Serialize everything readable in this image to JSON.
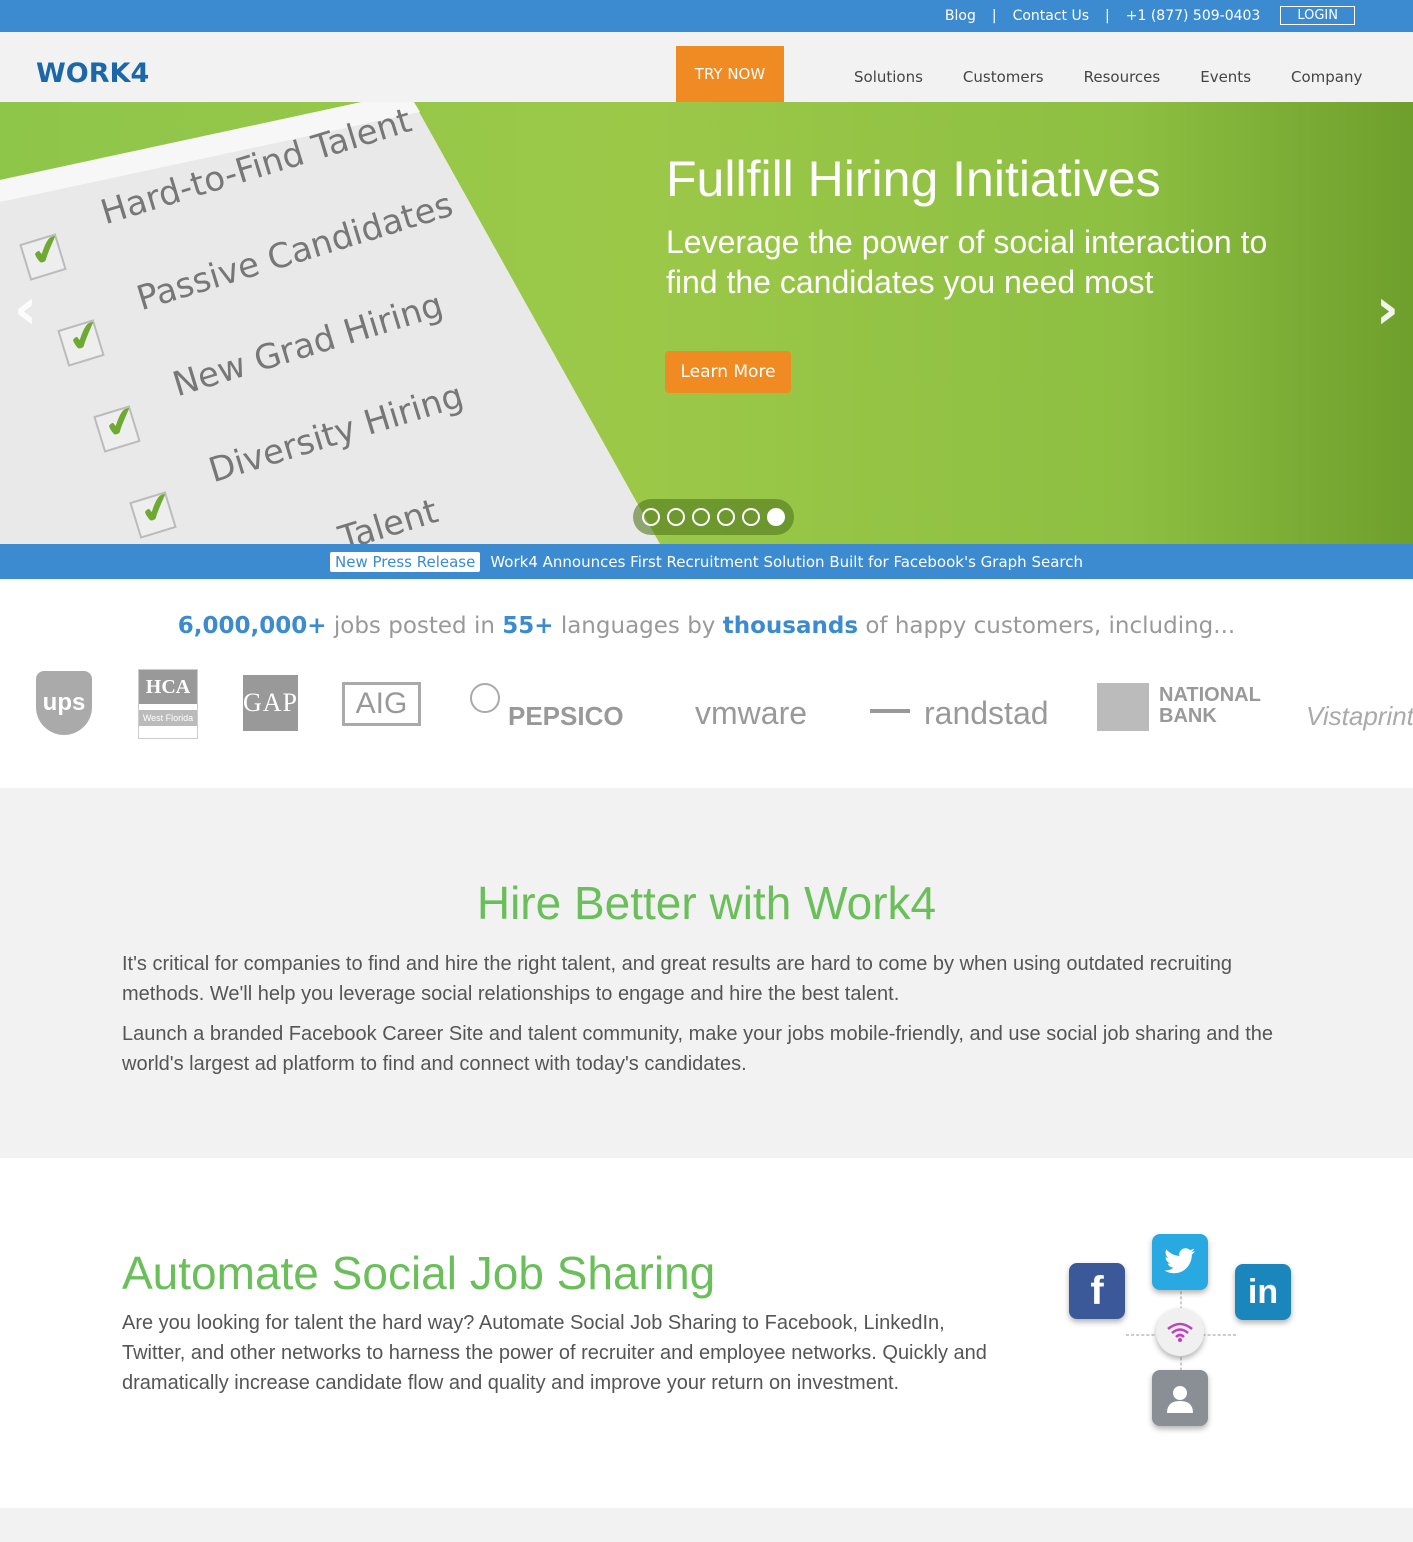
{
  "topbar": {
    "blog": "Blog",
    "contact": "Contact Us",
    "phone": "+1 (877) 509-0403",
    "login": "LOGIN",
    "separator": "|"
  },
  "header": {
    "logo": "WORK4",
    "try_now": "TRY NOW",
    "nav": [
      "Solutions",
      "Customers",
      "Resources",
      "Events",
      "Company"
    ]
  },
  "hero": {
    "checklist": [
      "Hard-to-Find Talent",
      "Passive Candidates",
      "New Grad Hiring",
      "Diversity Hiring",
      "Talent"
    ],
    "title": "Fullfill Hiring Initiatives",
    "subtitle": "Leverage the power of social interaction to find the candidates you need most",
    "cta": "Learn More",
    "slide_count": 6,
    "active_slide": 6,
    "prev_icon": "chevron-left-icon",
    "next_icon": "chevron-right-icon"
  },
  "press": {
    "tag": "New Press Release",
    "headline": "Work4 Announces First Recruitment Solution Built for Facebook's Graph Search"
  },
  "stats": {
    "jobs": "6,000,000+",
    "t1": " jobs posted in ",
    "languages": "55+",
    "t2": " languages by ",
    "customers": "thousands",
    "t3": " of happy customers, including..."
  },
  "clients": {
    "ups": "ups",
    "hca": "HCA",
    "hca_sub": "West Florida",
    "gap": "GAP",
    "aig": "AIG",
    "pepsico": "PEPSICO",
    "vmware": "vmware",
    "randstad": "randstad",
    "national_bank": "NATIONAL BANK",
    "vistaprint": "Vistaprint"
  },
  "hire": {
    "title": "Hire Better with Work4",
    "p1": "It's critical for companies to find and hire the right talent, and great results are hard to come by when using outdated recruiting methods. We'll help you leverage social relationships to engage and hire the best talent.",
    "p2": "Launch a branded Facebook Career Site and talent community, make your jobs mobile-friendly, and use social job sharing and the world's largest ad platform to find and connect with today's candidates."
  },
  "automate": {
    "title": "Automate Social Job Sharing",
    "body": "Are you looking for talent the hard way? Automate Social Job Sharing to Facebook, LinkedIn, Twitter, and other networks to harness the power of recruiter and employee networks. Quickly and dramatically increase candidate flow and quality and improve your return on investment.",
    "facebook_glyph": "f",
    "linkedin_glyph": "in"
  },
  "colors": {
    "brand_blue": "#3c8bd0",
    "orange": "#ef8b22",
    "green": "#6bbf5a"
  }
}
